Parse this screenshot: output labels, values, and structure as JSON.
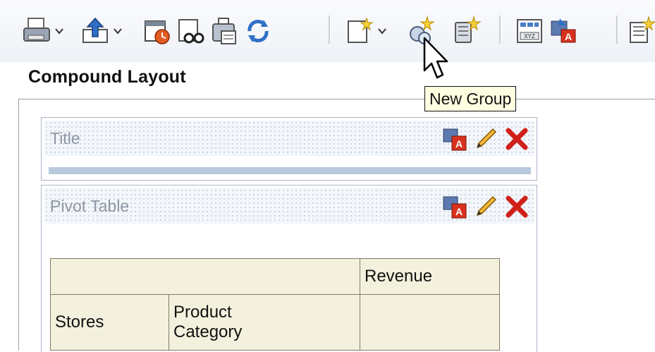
{
  "toolbar": {
    "buttons": [
      {
        "name": "print-icon"
      },
      {
        "name": "export-icon"
      },
      {
        "name": "schedule-icon"
      },
      {
        "name": "preview-icon"
      },
      {
        "name": "copy-icon"
      },
      {
        "name": "refresh-icon"
      },
      {
        "name": "new-view-icon"
      },
      {
        "name": "new-group-icon"
      },
      {
        "name": "new-calc-icon"
      },
      {
        "name": "xyz-icon"
      },
      {
        "name": "format-icon"
      },
      {
        "name": "properties-icon"
      }
    ]
  },
  "tooltip": {
    "text": "New Group"
  },
  "layout": {
    "title": "Compound Layout"
  },
  "views": {
    "title": {
      "label": "Title"
    },
    "pivot": {
      "label": "Pivot Table"
    }
  },
  "pivot_table": {
    "measure_header": "Revenue",
    "row_header_1": "Stores",
    "row_header_2_line1": "Product",
    "row_header_2_line2": "Category"
  },
  "colors": {
    "accent": "#2b4e9e",
    "delete": "#d0201a",
    "tooltip_bg": "#ffffe1"
  }
}
